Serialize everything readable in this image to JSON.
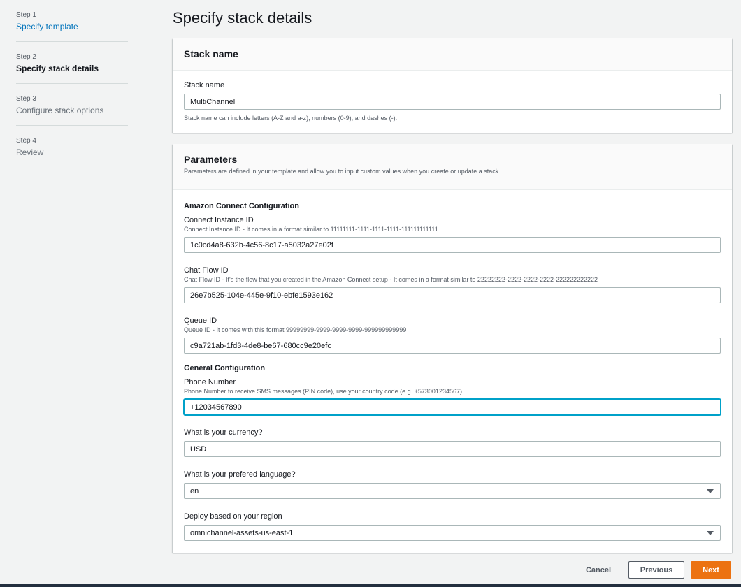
{
  "steps": [
    {
      "num": "Step 1",
      "title": "Specify template"
    },
    {
      "num": "Step 2",
      "title": "Specify stack details"
    },
    {
      "num": "Step 3",
      "title": "Configure stack options"
    },
    {
      "num": "Step 4",
      "title": "Review"
    }
  ],
  "page_title": "Specify stack details",
  "stack_name_panel": {
    "heading": "Stack name",
    "label": "Stack name",
    "value": "MultiChannel",
    "hint": "Stack name can include letters (A-Z and a-z), numbers (0-9), and dashes (-)."
  },
  "parameters_panel": {
    "heading": "Parameters",
    "description": "Parameters are defined in your template and allow you to input custom values when you create or update a stack.",
    "connect_section": "Amazon Connect Configuration",
    "instance_id": {
      "label": "Connect Instance ID",
      "hint": "Connect Instance ID - It comes in a format similar to 11111111-1111-1111-1111-111111111111",
      "value": "1c0cd4a8-632b-4c56-8c17-a5032a27e02f"
    },
    "chat_flow_id": {
      "label": "Chat Flow ID",
      "hint": "Chat Flow ID - It's the flow that you created in the Amazon Connect setup - It comes in a format similar to 22222222-2222-2222-2222-222222222222",
      "value": "26e7b525-104e-445e-9f10-ebfe1593e162"
    },
    "queue_id": {
      "label": "Queue ID",
      "hint": "Queue ID - It comes with this format 99999999-9999-9999-9999-999999999999",
      "value": "c9a721ab-1fd3-4de8-be67-680cc9e20efc"
    },
    "general_section": "General Configuration",
    "phone_number": {
      "label": "Phone Number",
      "hint": "Phone Number to receive SMS messages (PIN code), use your country code (e.g. +573001234567)",
      "value": "+12034567890"
    },
    "currency": {
      "label": "What is your currency?",
      "value": "USD"
    },
    "language": {
      "label": "What is your prefered language?",
      "value": "en"
    },
    "region": {
      "label": "Deploy based on your region",
      "value": "omnichannel-assets-us-east-1"
    }
  },
  "footer": {
    "cancel": "Cancel",
    "previous": "Previous",
    "next": "Next"
  },
  "colors": {
    "link": "#0073bb",
    "primary_button": "#ec7211",
    "focus": "#00a1c9"
  }
}
